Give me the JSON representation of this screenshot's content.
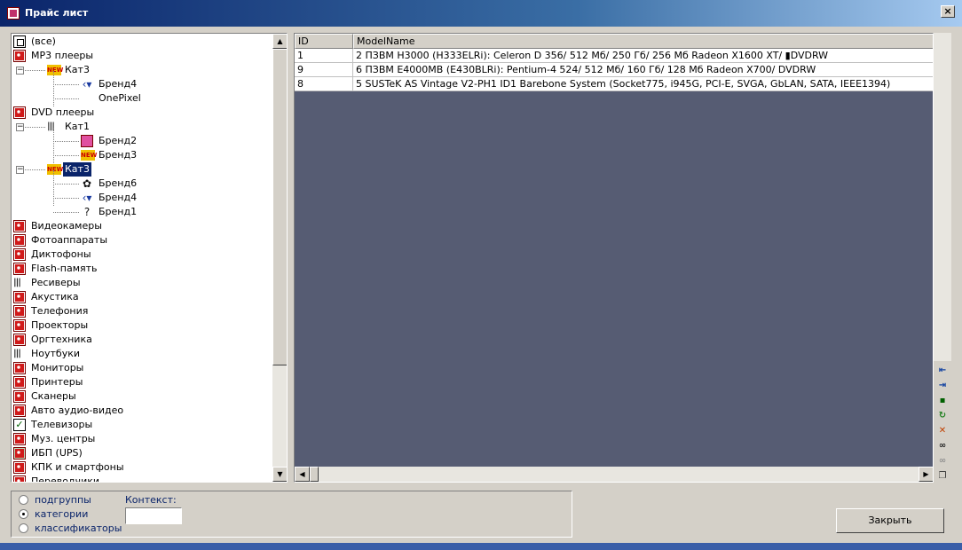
{
  "window": {
    "title": "Прайс лист",
    "close_glyph": "×"
  },
  "tree": {
    "rows": [
      {
        "label": "(все)",
        "icon": "all-icon"
      },
      {
        "label": "MP3 плееры",
        "icon": "category-icon"
      },
      {
        "label": "Кат3",
        "icon": "new-badge-icon"
      },
      {
        "label": "Бренд4",
        "icon": "brand-arrow-icon"
      },
      {
        "label": "OnePixel",
        "icon": ""
      },
      {
        "label": "DVD плееры",
        "icon": "category-icon"
      },
      {
        "label": "Кат1",
        "icon": "bars-icon"
      },
      {
        "label": "Бренд2",
        "icon": "pink-icon"
      },
      {
        "label": "Бренд3",
        "icon": "new-badge-icon"
      },
      {
        "label": "Кат3",
        "icon": "new-badge-icon"
      },
      {
        "label": "Бренд6",
        "icon": "flower-icon"
      },
      {
        "label": "Бренд4",
        "icon": "brand-arrow-icon"
      },
      {
        "label": "Бренд1",
        "icon": "question-icon"
      },
      {
        "label": "Видеокамеры",
        "icon": "category-icon"
      },
      {
        "label": "Фотоаппараты",
        "icon": "category-icon"
      },
      {
        "label": "Диктофоны",
        "icon": "category-icon"
      },
      {
        "label": "Flash-память",
        "icon": "category-icon"
      },
      {
        "label": "Ресиверы",
        "icon": "bars-icon"
      },
      {
        "label": "Акустика",
        "icon": "category-icon"
      },
      {
        "label": "Телефония",
        "icon": "category-icon"
      },
      {
        "label": "Проекторы",
        "icon": "category-icon"
      },
      {
        "label": "Оргтехника",
        "icon": "category-icon"
      },
      {
        "label": "Ноутбуки",
        "icon": "bars-icon"
      },
      {
        "label": "Мониторы",
        "icon": "category-icon"
      },
      {
        "label": "Принтеры",
        "icon": "category-icon"
      },
      {
        "label": "Сканеры",
        "icon": "category-icon"
      },
      {
        "label": "Авто аудио-видео",
        "icon": "category-icon"
      },
      {
        "label": "Телевизоры",
        "icon": "checkbox-icon"
      },
      {
        "label": "Муз. центры",
        "icon": "category-icon"
      },
      {
        "label": "ИБП (UPS)",
        "icon": "ups-icon"
      },
      {
        "label": "КПК и смартфоны",
        "icon": "category-icon"
      },
      {
        "label": "Переводчики",
        "icon": "category-icon"
      }
    ],
    "expander_minus": "−",
    "new_badge_text": "NEW",
    "bars_glyph": "|||",
    "check_glyph": "✓",
    "flower_glyph": "✿",
    "question_glyph": "?",
    "arrow_glyph": "‹▾"
  },
  "grid": {
    "columns": [
      {
        "label": "ID"
      },
      {
        "label": "ModelName"
      }
    ],
    "rows": [
      {
        "id": "1",
        "model": "2 ПЗВМ H3000 (H333ELRi): Celeron D 356/ 512 Мб/ 250 Гб/ 256 Мб Radeon X1600 XT/ ▮DVDRW"
      },
      {
        "id": "9",
        "model": "6 ПЗВМ E4000MB (E430BLRi): Pentium-4 524/ 512 Мб/ 160 Гб/ 128 Мб Radeon X700/ DVDRW"
      },
      {
        "id": "8",
        "model": "5 SUSTeK AS  Vintage V2-PH1 ID1 Barebone System (Socket775, i945G, PCI-E, SVGA, GbLAN, SATA, IEEE1394)"
      }
    ]
  },
  "scroll": {
    "up": "▲",
    "down": "▼",
    "left": "◀",
    "right": "▶"
  },
  "toolbar": [
    {
      "icon": "nav-left-icon",
      "glyph": "⇤"
    },
    {
      "icon": "nav-right-icon",
      "glyph": "⇥"
    },
    {
      "icon": "save-icon",
      "glyph": "▪"
    },
    {
      "icon": "refresh-icon",
      "glyph": "↻"
    },
    {
      "icon": "delete-icon",
      "glyph": "✕"
    },
    {
      "icon": "binoculars-icon",
      "glyph": "∞"
    },
    {
      "icon": "binoculars-disabled-icon",
      "glyph": "∞"
    },
    {
      "icon": "copy-icon",
      "glyph": "❐"
    }
  ],
  "options": {
    "radios": [
      {
        "label": "подгруппы",
        "checked": false
      },
      {
        "label": "категории",
        "checked": true
      },
      {
        "label": "классификаторы",
        "checked": false
      }
    ],
    "context_label": "Контекст:",
    "context_value": ""
  },
  "close_button": "Закрыть",
  "colors": {
    "grid_background": "#565c73",
    "selection": "#0a246a"
  }
}
